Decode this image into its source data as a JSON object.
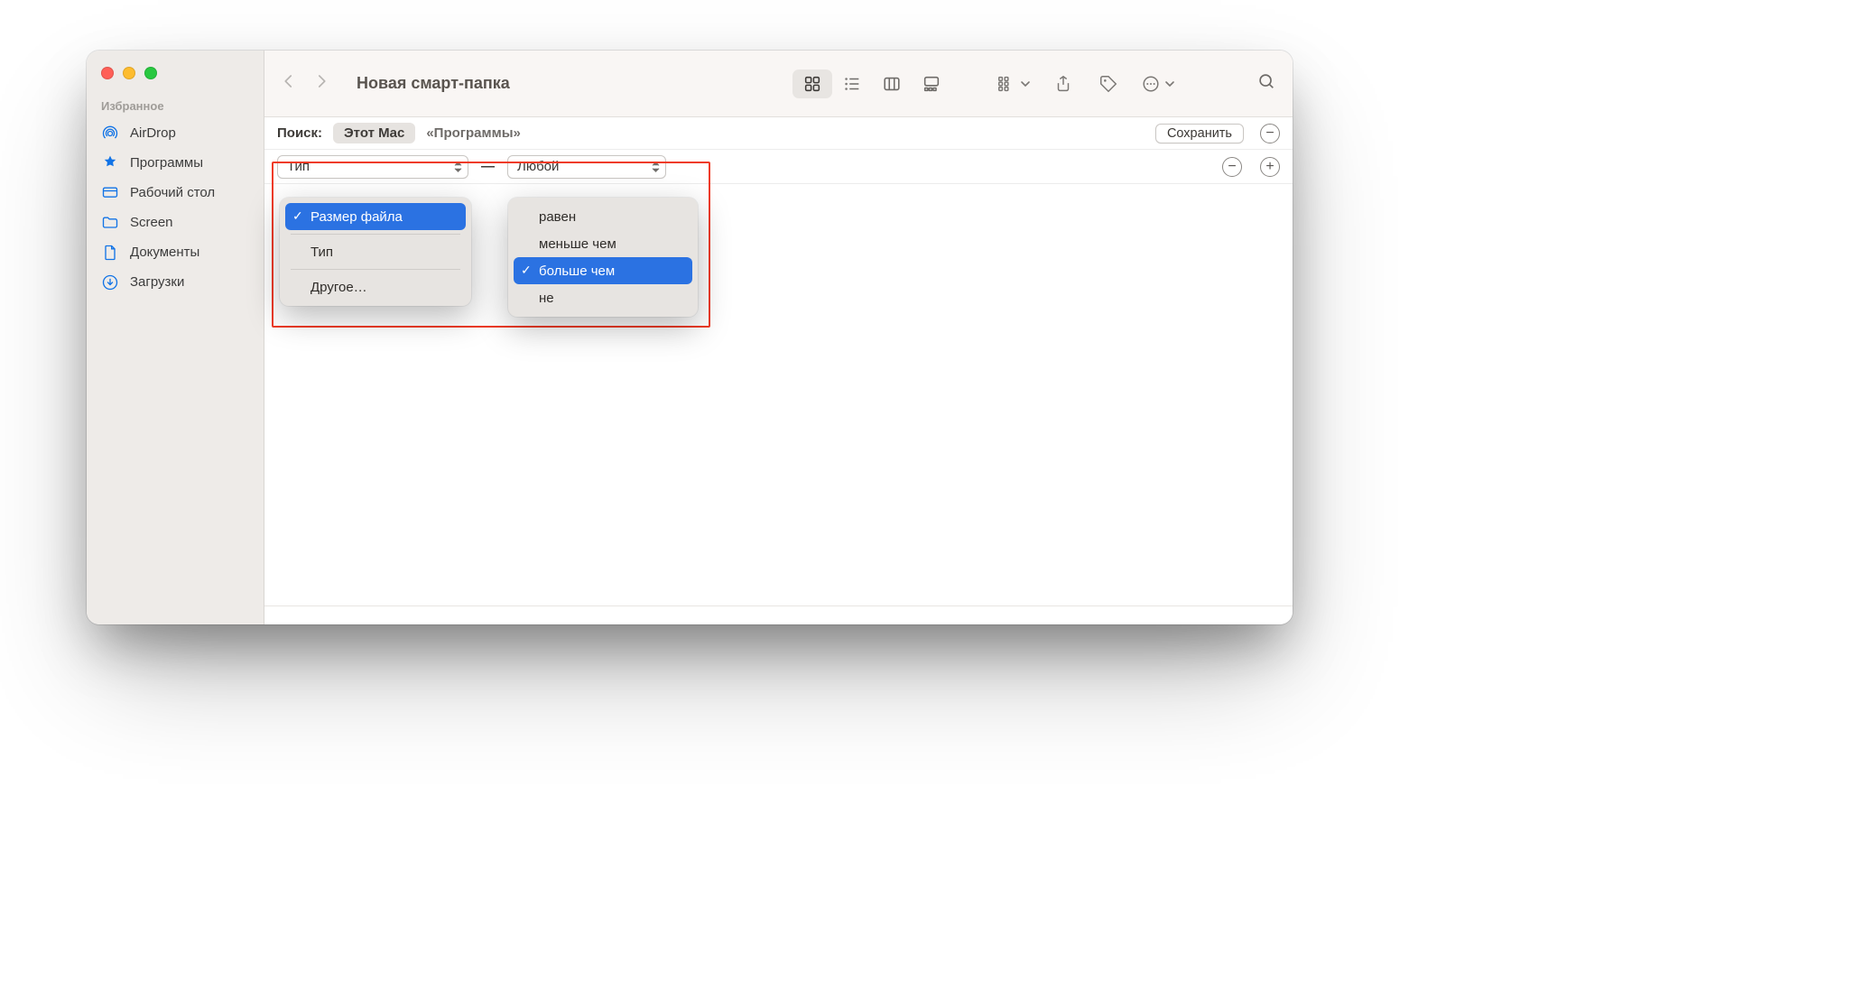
{
  "window": {
    "title": "Новая смарт-папка"
  },
  "sidebar": {
    "section": "Избранное",
    "items": [
      {
        "label": "AirDrop"
      },
      {
        "label": "Программы"
      },
      {
        "label": "Рабочий стол"
      },
      {
        "label": "Screen"
      },
      {
        "label": "Документы"
      },
      {
        "label": "Загрузки"
      }
    ]
  },
  "scope": {
    "label": "Поиск:",
    "current": "Этот Mac",
    "alt": "«Программы»",
    "save": "Сохранить"
  },
  "rule": {
    "attribute_combo": "Тип",
    "separator": "—",
    "value_combo": "Любой"
  },
  "dropdown_attr": {
    "selected_index": 0,
    "items": [
      "Размер файла",
      "Тип",
      "Другое…"
    ]
  },
  "dropdown_op": {
    "selected_index": 2,
    "items": [
      "равен",
      "меньше чем",
      "больше чем",
      "не"
    ]
  }
}
